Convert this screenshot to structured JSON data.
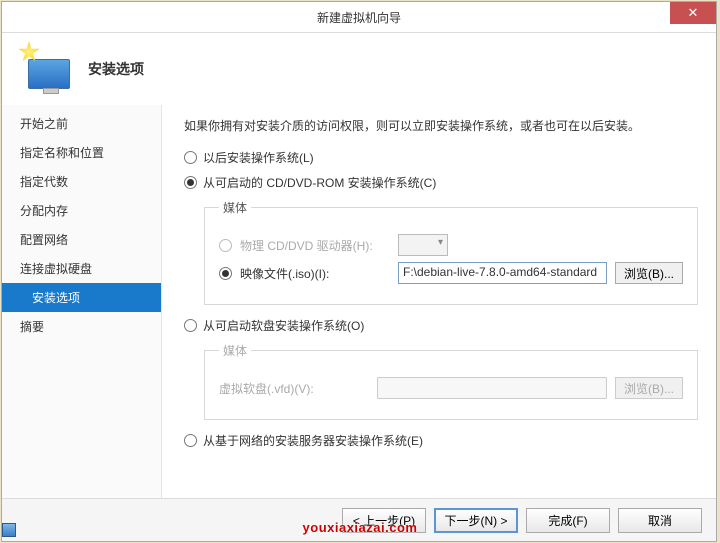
{
  "window": {
    "title": "新建虚拟机向导",
    "close": "✕"
  },
  "header": {
    "title": "安装选项"
  },
  "nav": {
    "items": [
      {
        "label": "开始之前"
      },
      {
        "label": "指定名称和位置"
      },
      {
        "label": "指定代数"
      },
      {
        "label": "分配内存"
      },
      {
        "label": "配置网络"
      },
      {
        "label": "连接虚拟硬盘"
      },
      {
        "label": "安装选项"
      },
      {
        "label": "摘要"
      }
    ]
  },
  "content": {
    "desc": "如果你拥有对安装介质的访问权限，则可以立即安装操作系统，或者也可在以后安装。",
    "opt_later": "以后安装操作系统(L)",
    "opt_cddvd": "从可启动的 CD/DVD-ROM 安装操作系统(C)",
    "opt_floppy": "从可启动软盘安装操作系统(O)",
    "opt_network": "从基于网络的安装服务器安装操作系统(E)",
    "media_legend": "媒体",
    "physical_label": "物理 CD/DVD 驱动器(H):",
    "iso_label": "映像文件(.iso)(I):",
    "iso_value": "F:\\debian-live-7.8.0-amd64-standard",
    "vfd_label": "虚拟软盘(.vfd)(V):",
    "browse": "浏览(B)..."
  },
  "footer": {
    "prev": "< 上一步(P)",
    "next": "下一步(N) >",
    "finish": "完成(F)",
    "cancel": "取消"
  },
  "watermark": "youxiaxiazai.com"
}
